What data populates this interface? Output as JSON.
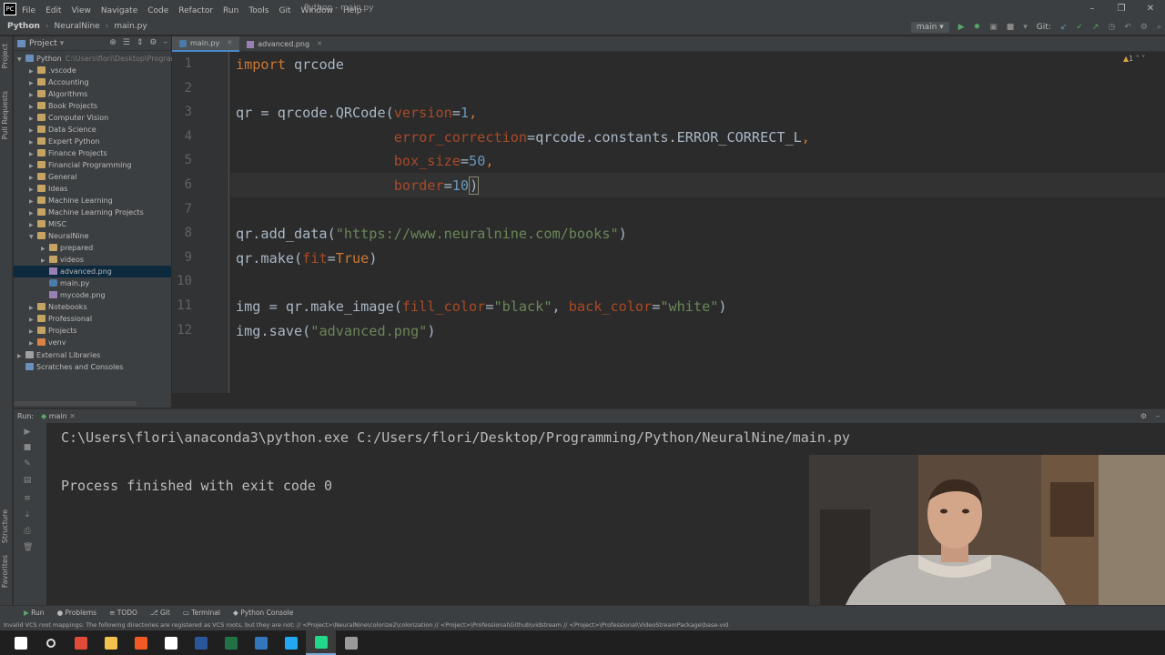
{
  "menu": {
    "items": [
      "File",
      "Edit",
      "View",
      "Navigate",
      "Code",
      "Refactor",
      "Run",
      "Tools",
      "Git",
      "Window",
      "Help"
    ],
    "window_title": "Python - main.py"
  },
  "breadcrumb": {
    "items": [
      "Python",
      "NeuralNine",
      "main.py"
    ]
  },
  "toolbar": {
    "run_config": "main",
    "git_label": "Git:"
  },
  "project_panel": {
    "title": "Project",
    "root": {
      "name": "Python",
      "path": "C:\\Users\\flori\\Desktop\\Programmi"
    },
    "items": [
      {
        "name": ".vscode",
        "type": "folder",
        "depth": 1,
        "expanded": false
      },
      {
        "name": "Accounting",
        "type": "folder",
        "depth": 1,
        "expanded": false
      },
      {
        "name": "Algorithms",
        "type": "folder",
        "depth": 1,
        "expanded": false
      },
      {
        "name": "Book Projects",
        "type": "folder",
        "depth": 1,
        "expanded": false
      },
      {
        "name": "Computer Vision",
        "type": "folder",
        "depth": 1,
        "expanded": false
      },
      {
        "name": "Data Science",
        "type": "folder",
        "depth": 1,
        "expanded": false
      },
      {
        "name": "Expert Python",
        "type": "folder",
        "depth": 1,
        "expanded": false
      },
      {
        "name": "Finance Projects",
        "type": "folder",
        "depth": 1,
        "expanded": false
      },
      {
        "name": "Financial Programming",
        "type": "folder",
        "depth": 1,
        "expanded": false
      },
      {
        "name": "General",
        "type": "folder",
        "depth": 1,
        "expanded": false
      },
      {
        "name": "Ideas",
        "type": "folder",
        "depth": 1,
        "expanded": false
      },
      {
        "name": "Machine Learning",
        "type": "folder",
        "depth": 1,
        "expanded": false
      },
      {
        "name": "Machine Learning Projects",
        "type": "folder",
        "depth": 1,
        "expanded": false
      },
      {
        "name": "MISC",
        "type": "folder",
        "depth": 1,
        "expanded": false
      },
      {
        "name": "NeuralNine",
        "type": "folder",
        "depth": 1,
        "expanded": true
      },
      {
        "name": "prepared",
        "type": "folder",
        "depth": 2,
        "expanded": false
      },
      {
        "name": "videos",
        "type": "folder",
        "depth": 2,
        "expanded": false
      },
      {
        "name": "advanced.png",
        "type": "png",
        "depth": 2,
        "selected": true
      },
      {
        "name": "main.py",
        "type": "py",
        "depth": 2
      },
      {
        "name": "mycode.png",
        "type": "png",
        "depth": 2
      },
      {
        "name": "Notebooks",
        "type": "folder",
        "depth": 1,
        "expanded": false
      },
      {
        "name": "Professional",
        "type": "folder",
        "depth": 1,
        "expanded": false
      },
      {
        "name": "Projects",
        "type": "folder",
        "depth": 1,
        "expanded": false
      },
      {
        "name": "venv",
        "type": "folder-excluded",
        "depth": 1,
        "expanded": false
      },
      {
        "name": "External Libraries",
        "type": "lib",
        "depth": 0,
        "expanded": false
      },
      {
        "name": "Scratches and Consoles",
        "type": "scratch",
        "depth": 0
      }
    ]
  },
  "editor": {
    "tabs": [
      {
        "label": "main.py",
        "active": true
      },
      {
        "label": "advanced.png",
        "active": false
      }
    ],
    "line_numbers": [
      "1",
      "2",
      "3",
      "4",
      "5",
      "6",
      "7",
      "8",
      "9",
      "10",
      "11",
      "12"
    ],
    "code_lines": [
      "import qrcode",
      "",
      "qr = qrcode.QRCode(version=1,",
      "                   error_correction=qrcode.constants.ERROR_CORRECT_L,",
      "                   box_size=50,",
      "                   border=10)",
      "",
      "qr.add_data(\"https://www.neuralnine.com/books\")",
      "qr.make(fit=True)",
      "",
      "img = qr.make_image(fill_color=\"black\", back_color=\"white\")",
      "img.save(\"advanced.png\")"
    ],
    "inspection_count": "1"
  },
  "run_panel": {
    "title": "Run:",
    "config": "main",
    "output": [
      "C:\\Users\\flori\\anaconda3\\python.exe C:/Users/flori/Desktop/Programming/Python/NeuralNine/main.py",
      "",
      "Process finished with exit code 0"
    ]
  },
  "tool_windows": {
    "bottom": [
      "Run",
      "Problems",
      "TODO",
      "Git",
      "Terminal",
      "Python Console"
    ],
    "left": [
      "Project",
      "Pull Requests",
      "Structure",
      "Favorites"
    ]
  },
  "status_bar": {
    "message": "Invalid VCS root mappings: The following directories are registered as VCS roots, but they are not: // <Project>\\NeuralNine\\colorize2\\colorization // <Project>\\Professional\\Github\\vidstream // <Project>\\Professional\\VideoStreamPackage\\base-vid"
  },
  "taskbar": {
    "icons": [
      "windows-start-icon",
      "search-icon",
      "chrome-icon",
      "file-explorer-icon",
      "brave-icon",
      "notion-icon",
      "word-icon",
      "excel-icon",
      "edge-icon",
      "vscode-icon",
      "pycharm-icon",
      "obs-icon"
    ]
  },
  "colors": {
    "background": "#2b2b2b",
    "panel": "#3c3f41",
    "keyword": "#cc7832",
    "string": "#6a8759",
    "number": "#6897bb",
    "parameter": "#aa4926",
    "selection": "#0d293e"
  }
}
